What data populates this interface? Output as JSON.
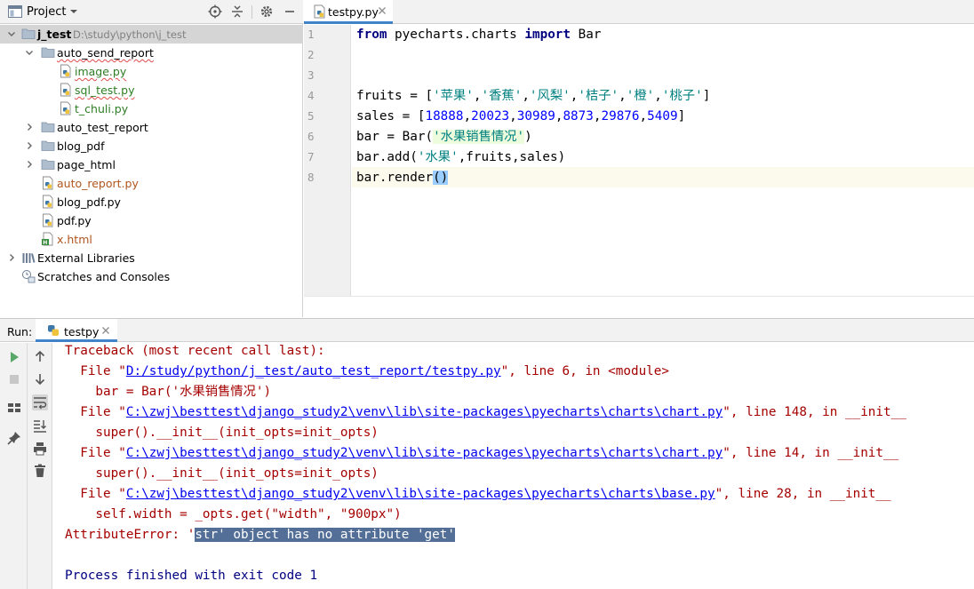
{
  "project": {
    "title": "Project",
    "tree": [
      {
        "label": "j_test",
        "path": "D:\\study\\python\\j_test",
        "depth": 0,
        "kind": "folder",
        "expanded": true,
        "selected": true
      },
      {
        "label": "auto_send_report",
        "depth": 1,
        "kind": "folder",
        "expanded": true,
        "squiggle": true
      },
      {
        "label": "image.py",
        "depth": 2,
        "kind": "python",
        "color": "green",
        "squiggle": true
      },
      {
        "label": "sql_test.py",
        "depth": 2,
        "kind": "python",
        "color": "green",
        "squiggle": true
      },
      {
        "label": "t_chuli.py",
        "depth": 2,
        "kind": "python",
        "color": "green"
      },
      {
        "label": "auto_test_report",
        "depth": 1,
        "kind": "folder",
        "expanded": false
      },
      {
        "label": "blog_pdf",
        "depth": 1,
        "kind": "folder",
        "expanded": false
      },
      {
        "label": "page_html",
        "depth": 1,
        "kind": "folder",
        "expanded": false
      },
      {
        "label": "auto_report.py",
        "depth": 1,
        "kind": "python",
        "color": "orange"
      },
      {
        "label": "blog_pdf.py",
        "depth": 1,
        "kind": "python"
      },
      {
        "label": "pdf.py",
        "depth": 1,
        "kind": "python"
      },
      {
        "label": "x.html",
        "depth": 1,
        "kind": "html",
        "color": "orange"
      },
      {
        "label": "External Libraries",
        "depth": 0,
        "kind": "libraries",
        "expanded": false
      },
      {
        "label": "Scratches and Consoles",
        "depth": 0,
        "kind": "scratches"
      }
    ]
  },
  "editor": {
    "tab_label": "testpy.py",
    "line_numbers": [
      "1",
      "2",
      "3",
      "4",
      "5",
      "6",
      "7",
      "8"
    ],
    "code": [
      [
        {
          "t": "from",
          "c": "kw"
        },
        {
          "t": " pyecharts.charts "
        },
        {
          "t": "import",
          "c": "kw"
        },
        {
          "t": " Bar"
        }
      ],
      [],
      [],
      [
        {
          "t": "fruits = ["
        },
        {
          "t": "'苹果'",
          "c": "str"
        },
        {
          "t": ","
        },
        {
          "t": "'香蕉'",
          "c": "str"
        },
        {
          "t": ","
        },
        {
          "t": "'风梨'",
          "c": "str"
        },
        {
          "t": ","
        },
        {
          "t": "'桔子'",
          "c": "str"
        },
        {
          "t": ","
        },
        {
          "t": "'橙'",
          "c": "str"
        },
        {
          "t": ","
        },
        {
          "t": "'桃子'",
          "c": "str"
        },
        {
          "t": "]"
        }
      ],
      [
        {
          "t": "sales = ["
        },
        {
          "t": "18888",
          "c": "num"
        },
        {
          "t": ","
        },
        {
          "t": "20023",
          "c": "num"
        },
        {
          "t": ","
        },
        {
          "t": "30989",
          "c": "num"
        },
        {
          "t": ","
        },
        {
          "t": "8873",
          "c": "num"
        },
        {
          "t": ","
        },
        {
          "t": "29876",
          "c": "num"
        },
        {
          "t": ","
        },
        {
          "t": "5409",
          "c": "num"
        },
        {
          "t": "]"
        }
      ],
      [
        {
          "t": "bar = Bar("
        },
        {
          "t": "'水果销售情况'",
          "c": "str strhl"
        },
        {
          "t": ")"
        }
      ],
      [
        {
          "t": "bar.add("
        },
        {
          "t": "'水果'",
          "c": "str"
        },
        {
          "t": ",fruits,sales)"
        }
      ],
      [
        {
          "t": "bar.render"
        },
        {
          "t": "()",
          "c": "brhl"
        }
      ]
    ]
  },
  "run": {
    "label": "Run:",
    "tab_label": "testpy",
    "console": [
      [
        {
          "t": "Traceback (most recent call last):"
        }
      ],
      [
        {
          "t": "  File \""
        },
        {
          "t": "D:/study/python/j_test/auto_test_report/testpy.py",
          "link": true
        },
        {
          "t": "\", line 6, in <module>"
        }
      ],
      [
        {
          "t": "    bar = Bar('水果销售情况')"
        }
      ],
      [
        {
          "t": "  File \""
        },
        {
          "t": "C:\\zwj\\besttest\\django_study2\\venv\\lib\\site-packages\\pyecharts\\charts\\chart.py",
          "link": true
        },
        {
          "t": "\", line 148, in __init__"
        }
      ],
      [
        {
          "t": "    super().__init__(init_opts=init_opts)"
        }
      ],
      [
        {
          "t": "  File \""
        },
        {
          "t": "C:\\zwj\\besttest\\django_study2\\venv\\lib\\site-packages\\pyecharts\\charts\\chart.py",
          "link": true
        },
        {
          "t": "\", line 14, in __init__"
        }
      ],
      [
        {
          "t": "    super().__init__(init_opts=init_opts)"
        }
      ],
      [
        {
          "t": "  File \""
        },
        {
          "t": "C:\\zwj\\besttest\\django_study2\\venv\\lib\\site-packages\\pyecharts\\charts\\base.py",
          "link": true
        },
        {
          "t": "\", line 28, in __init__"
        }
      ],
      [
        {
          "t": "    self.width = _opts.get(\"width\", \"900px\")"
        }
      ],
      [
        {
          "t": "AttributeError: '"
        },
        {
          "t": "str' object has no attribute 'get'",
          "sel": true
        }
      ],
      [],
      [
        {
          "t": "Process finished with exit code 1",
          "normal": true
        }
      ]
    ]
  },
  "colors": {
    "keyword": "#000080",
    "string": "#008080",
    "number": "#0000ff",
    "error_text": "#a50000",
    "link": "#0000ee",
    "selection": "#536e97",
    "accent_tab": "#4083c9"
  }
}
